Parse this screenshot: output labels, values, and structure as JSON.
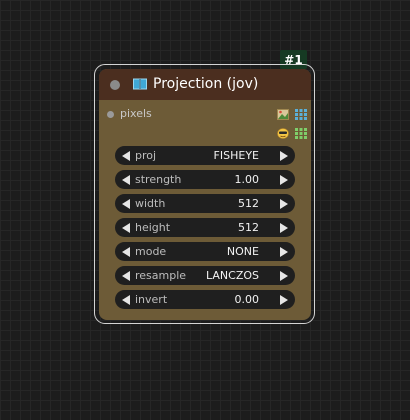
{
  "node": {
    "id_badge": "#1",
    "title": "Projection (jov)",
    "input_slot": "pixels",
    "widgets": [
      {
        "label": "proj",
        "value": "FISHEYE"
      },
      {
        "label": "strength",
        "value": "1.00"
      },
      {
        "label": "width",
        "value": "512"
      },
      {
        "label": "height",
        "value": "512"
      },
      {
        "label": "mode",
        "value": "NONE"
      },
      {
        "label": "resample",
        "value": "LANCZOS"
      },
      {
        "label": "invert",
        "value": "0.00"
      }
    ]
  },
  "colors": {
    "header": "#4b2e1f",
    "body": "#6d5b37",
    "badge": "#163a23",
    "widget": "#1f1f1f"
  },
  "icons": [
    "book-icon",
    "image-output-icon",
    "grid-output-icon",
    "mask-output-icon"
  ]
}
